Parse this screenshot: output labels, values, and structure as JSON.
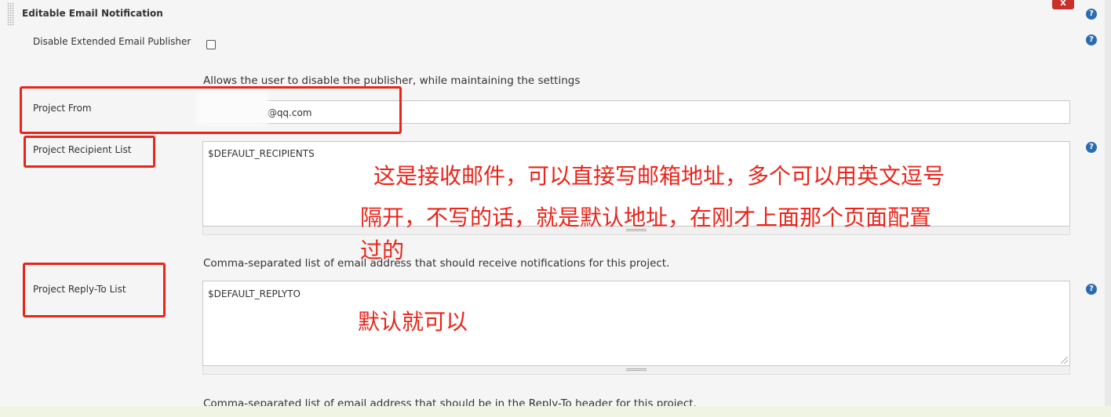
{
  "section": {
    "title": "Editable Email Notification",
    "close_label": "X",
    "help_icon_text": "?"
  },
  "disable_publisher": {
    "label": "Disable Extended Email Publisher",
    "checked": false,
    "description": "Allows the user to disable the publisher, while maintaining the settings"
  },
  "project_from": {
    "label": "Project From",
    "value": ".@qq.com"
  },
  "recipient_list": {
    "label": "Project Recipient List",
    "value": "$DEFAULT_RECIPIENTS",
    "description": "Comma-separated list of email address that should receive notifications for this project."
  },
  "reply_to": {
    "label": "Project Reply-To List",
    "value": "$DEFAULT_REPLYTO",
    "description": "Comma-separated list of email address that should be in the Reply-To header for this project."
  },
  "annotations": {
    "recipient_note_line1": "这是接收邮件，可以直接写邮箱地址，多个可以用英文逗号",
    "recipient_note_line2": "隔开，不写的话，就是默认地址，在刚才上面那个页面配置",
    "recipient_note_line3": "过的",
    "replyto_note": "默认就可以"
  },
  "colors": {
    "annotation_red": "#e8251b",
    "help_blue": "#2b6cb0",
    "close_red": "#c9302c"
  }
}
